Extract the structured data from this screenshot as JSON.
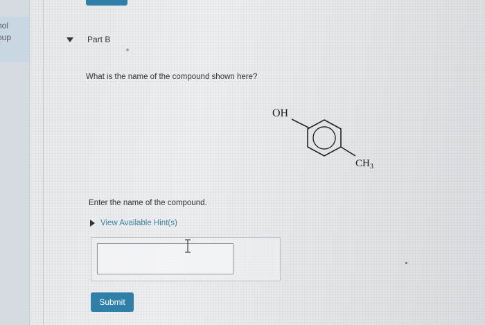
{
  "sidebar": {
    "line1": "nol",
    "line2": "oup"
  },
  "part": {
    "label": "Part B"
  },
  "question": {
    "text": "What is the name of the compound shown here?"
  },
  "molecule": {
    "oh_label": "OH",
    "ch3_label": "CH",
    "ch3_subscript": "3"
  },
  "answer": {
    "prompt": "Enter the name of the compound.",
    "hints_label": "View Available Hint(s)",
    "input_value": ""
  },
  "actions": {
    "submit_label": "Submit"
  },
  "colors": {
    "accent": "#2f7fa8",
    "hint_link": "#3b7fa8"
  }
}
